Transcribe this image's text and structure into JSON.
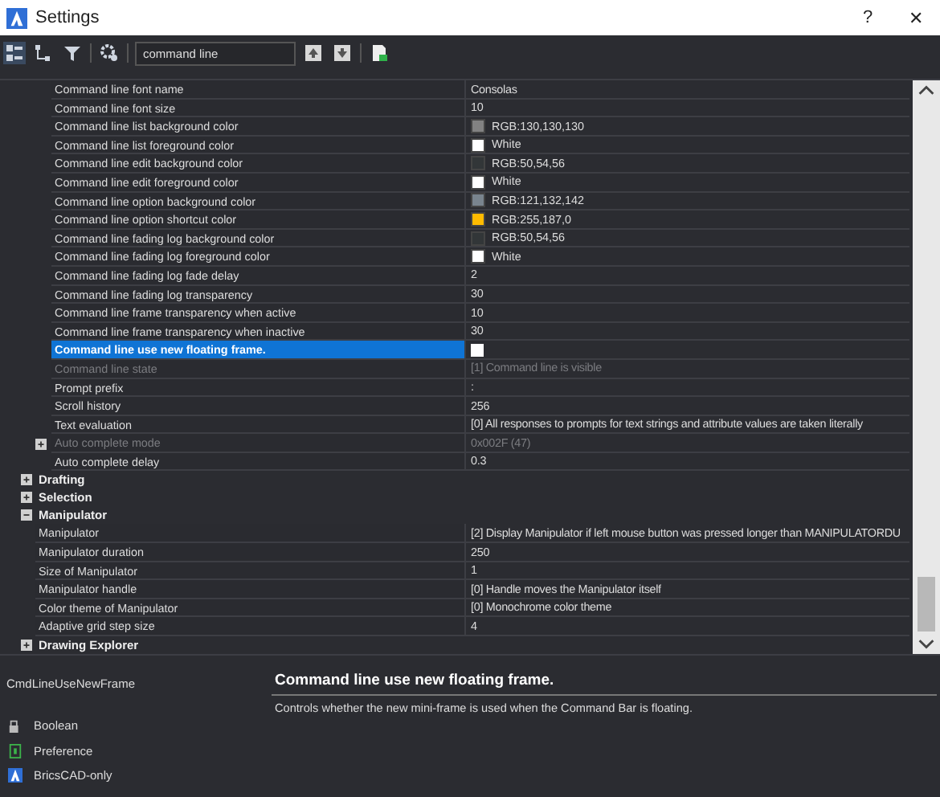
{
  "window": {
    "title": "Settings",
    "help": "?",
    "close": "✕"
  },
  "toolbar": {
    "search": "command line"
  },
  "command_line_settings": [
    {
      "name": "Command line font name",
      "value": "Consolas",
      "kind": "text",
      "selected": false,
      "disabled": false
    },
    {
      "name": "Command line font size",
      "value": "10",
      "kind": "text",
      "selected": false,
      "disabled": false
    },
    {
      "name": "Command line list background color",
      "value": "RGB:130,130,130",
      "kind": "color",
      "color": "#828282",
      "selected": false,
      "disabled": false
    },
    {
      "name": "Command line list foreground color",
      "value": "White",
      "kind": "color",
      "color": "#ffffff",
      "selected": false,
      "disabled": false
    },
    {
      "name": "Command line edit background color",
      "value": "RGB:50,54,56",
      "kind": "color",
      "color": "#323638",
      "selected": false,
      "disabled": false
    },
    {
      "name": "Command line edit foreground color",
      "value": "White",
      "kind": "color",
      "color": "#ffffff",
      "selected": false,
      "disabled": false
    },
    {
      "name": "Command line option background color",
      "value": "RGB:121,132,142",
      "kind": "color",
      "color": "#79848e",
      "selected": false,
      "disabled": false
    },
    {
      "name": "Command line option shortcut color",
      "value": "RGB:255,187,0",
      "kind": "color",
      "color": "#ffbb00",
      "selected": false,
      "disabled": false
    },
    {
      "name": "Command line fading log background color",
      "value": "RGB:50,54,56",
      "kind": "color",
      "color": "#323638",
      "selected": false,
      "disabled": false
    },
    {
      "name": "Command line fading log foreground color",
      "value": "White",
      "kind": "color",
      "color": "#ffffff",
      "selected": false,
      "disabled": false
    },
    {
      "name": "Command line fading log fade delay",
      "value": "2",
      "kind": "text",
      "selected": false,
      "disabled": false
    },
    {
      "name": "Command line fading log transparency",
      "value": "30",
      "kind": "text",
      "selected": false,
      "disabled": false
    },
    {
      "name": "Command line frame transparency when active",
      "value": "10",
      "kind": "text",
      "selected": false,
      "disabled": false
    },
    {
      "name": "Command line frame transparency when inactive",
      "value": "30",
      "kind": "text",
      "selected": false,
      "disabled": false
    },
    {
      "name": "Command line use new floating frame.",
      "kind": "checkbox",
      "checked": false,
      "selected": true,
      "disabled": false
    },
    {
      "name": "Command line state",
      "value": "[1] Command line is visible",
      "kind": "text",
      "selected": false,
      "disabled": true
    },
    {
      "name": "Prompt prefix",
      "value": ":",
      "kind": "text",
      "selected": false,
      "disabled": false
    },
    {
      "name": "Scroll history",
      "value": "256",
      "kind": "text",
      "selected": false,
      "disabled": false
    },
    {
      "name": "Text evaluation",
      "value": "[0] All responses to prompts for text strings and attribute values are taken literally",
      "kind": "text",
      "selected": false,
      "disabled": false
    },
    {
      "name": "Auto complete mode",
      "value": "0x002F (47)",
      "kind": "text",
      "selected": false,
      "disabled": true,
      "expandable": true
    },
    {
      "name": "Auto complete delay",
      "value": "0.3",
      "kind": "text",
      "selected": false,
      "disabled": false
    }
  ],
  "categories": [
    {
      "label": "Drafting",
      "expanded": false
    },
    {
      "label": "Selection",
      "expanded": false
    },
    {
      "label": "Manipulator",
      "expanded": true,
      "children": [
        {
          "name": "Manipulator",
          "value": "[2] Display Manipulator if left mouse button was pressed longer than MANIPULATORDU"
        },
        {
          "name": "Manipulator duration",
          "value": "250"
        },
        {
          "name": "Size of Manipulator",
          "value": "1"
        },
        {
          "name": "Manipulator handle",
          "value": "[0] Handle moves the Manipulator itself"
        },
        {
          "name": "Color theme of Manipulator",
          "value": "[0] Monochrome color theme"
        },
        {
          "name": "Adaptive grid step size",
          "value": "4"
        }
      ]
    },
    {
      "label": "Drawing Explorer",
      "expanded": false
    }
  ],
  "details": {
    "variable": "CmdLineUseNewFrame",
    "title": "Command line use new floating frame.",
    "description": "Controls whether the new mini-frame is used when the Command Bar is floating.",
    "type": "Boolean",
    "scope": "Preference",
    "product": "BricsCAD-only"
  }
}
